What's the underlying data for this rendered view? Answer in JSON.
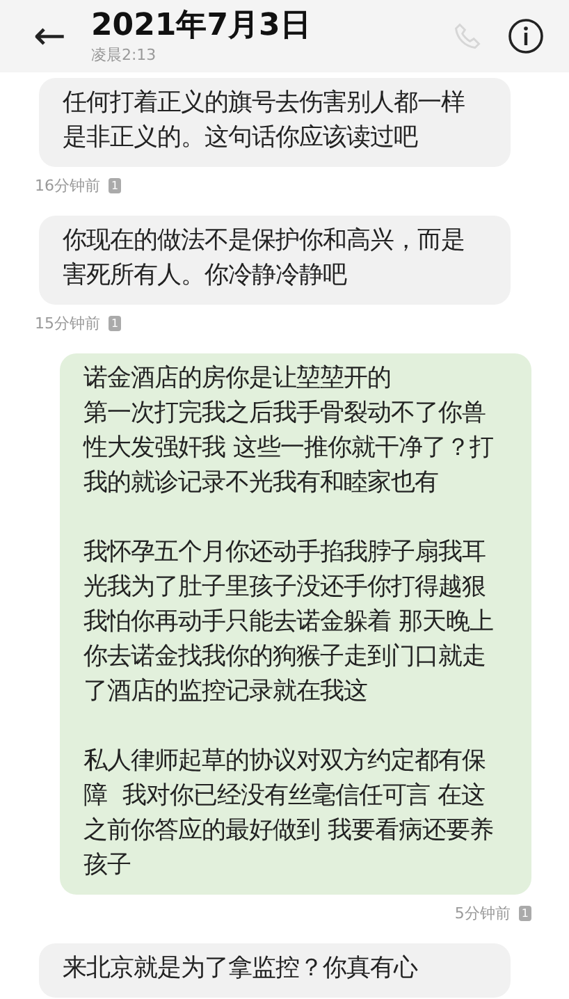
{
  "header": {
    "back": "←",
    "title": "2021年7月3日",
    "subtitle": "凌晨2:13",
    "call_disabled": true
  },
  "messages": [
    {
      "kind": "incoming",
      "blocks": [
        [
          "任何打着正义的旗号去伤害别人都一样是非正义的。这句话你应该读过吧"
        ]
      ],
      "time": "16分钟前",
      "sim": "1"
    },
    {
      "kind": "incoming",
      "blocks": [
        [
          "你现在的做法不是保护你和高兴，而是害死所有人。你冷静冷静吧"
        ]
      ],
      "time": "15分钟前",
      "sim": "1"
    },
    {
      "kind": "outgoing",
      "blocks": [
        [
          "诺金酒店的房你是让堃堃开的",
          "第一次打完我之后我手骨裂动不了你兽性大发强奸我 这些一推你就干净了？打我的就诊记录不光我有和睦家也有"
        ],
        [
          "我怀孕五个月你还动手掐我脖子扇我耳光我为了肚子里孩子没还手你打得越狠我怕你再动手只能去诺金躲着 那天晚上你去诺金找我你的狗猴子走到门口就走了酒店的监控记录就在我这"
        ],
        [
          "私人律师起草的协议对双方约定都有保障  我对你已经没有丝毫信任可言 在这之前你答应的最好做到 我要看病还要养孩子"
        ]
      ],
      "time": "5分钟前",
      "sim": "1"
    },
    {
      "kind": "incoming",
      "blocks": [
        [
          "来北京就是为了拿监控？你真有心"
        ]
      ]
    }
  ]
}
